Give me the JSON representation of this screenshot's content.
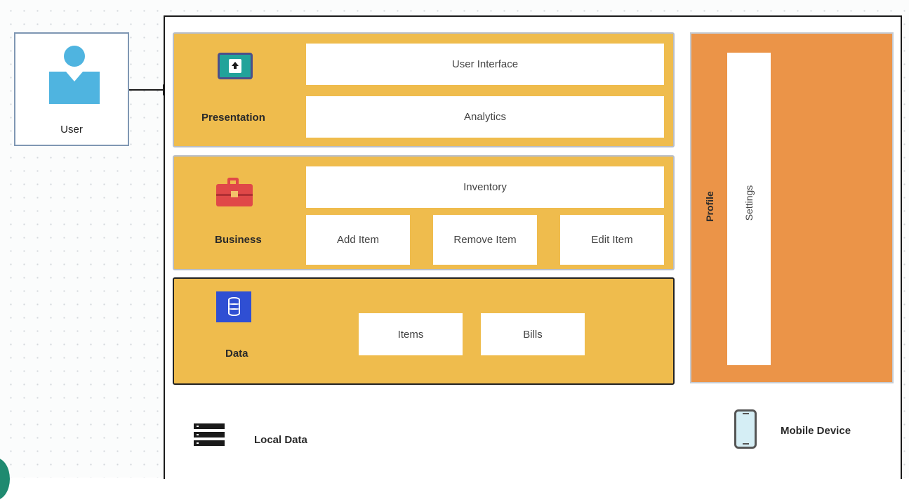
{
  "user": {
    "label": "User"
  },
  "layers": {
    "presentation": {
      "label": "Presentation",
      "icon": "monitor-upload-icon",
      "components": [
        "User Interface",
        "Analytics"
      ]
    },
    "business": {
      "label": "Business",
      "icon": "briefcase-icon",
      "components": [
        "Inventory",
        "Add Item",
        "Remove Item",
        "Edit Item"
      ]
    },
    "data": {
      "label": "Data",
      "icon": "database-icon",
      "components": [
        "Items",
        "Bills"
      ]
    }
  },
  "side_panel": {
    "profile_label": "Profile",
    "settings_label": "Settings"
  },
  "footer": {
    "local_data_label": "Local Data",
    "local_data_icon": "server-icon",
    "mobile_device_label": "Mobile Device",
    "mobile_device_icon": "mobile-phone-icon"
  },
  "colors": {
    "layer_fill": "#efbc4d",
    "profile_fill": "#eb9448",
    "user_icon": "#4fb4e0",
    "briefcase": "#e04848",
    "database": "#2f4fd3",
    "monitor": "#22a39a"
  }
}
